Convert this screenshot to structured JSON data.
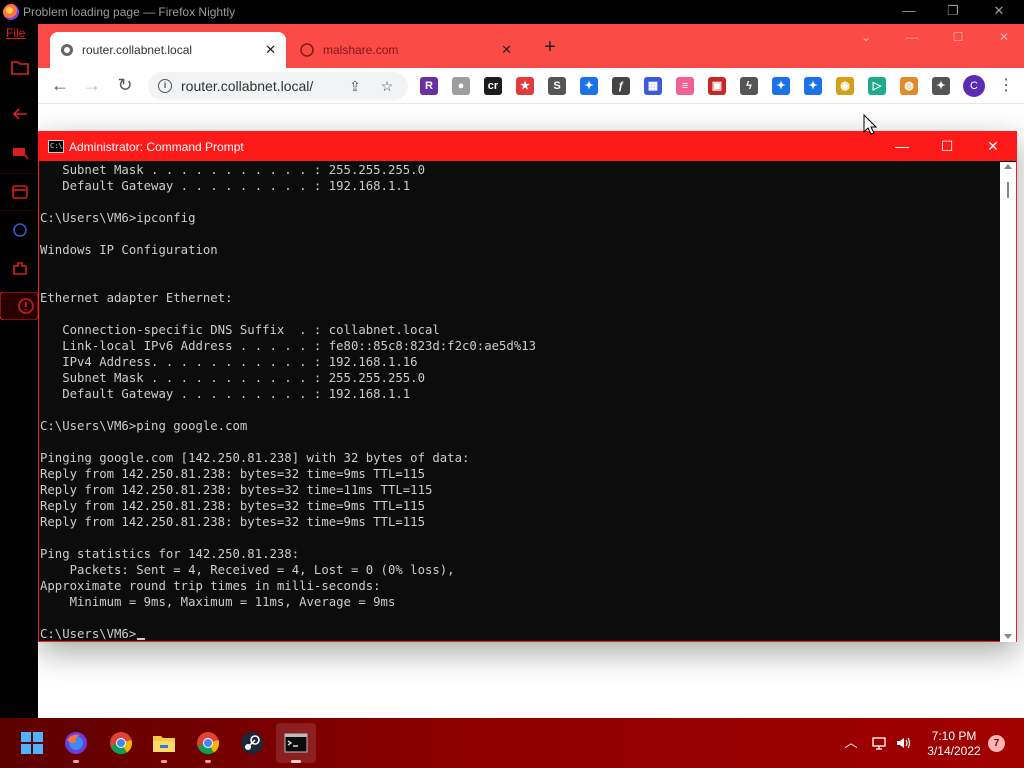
{
  "firefox": {
    "title": "Problem loading page — Firefox Nightly",
    "menu_file": "File",
    "controls": {
      "minimize": "—",
      "restore": "❐",
      "close": "✕"
    }
  },
  "chrome": {
    "tabs": [
      {
        "label": "router.collabnet.local",
        "close": "✕"
      },
      {
        "label": "malshare.com",
        "close": "✕"
      }
    ],
    "new_tab": "+",
    "controls": {
      "dropdown": "⌄",
      "minimize": "—",
      "maximize": "☐",
      "close": "✕"
    },
    "nav": {
      "back": "←",
      "forward": "→",
      "reload": "↻"
    },
    "address": "router.collabnet.local/",
    "omni": {
      "share": "⇪",
      "star": "☆"
    },
    "extensions": [
      {
        "icon": "r-extension-icon",
        "glyph": "R",
        "color": "#6a2fa0"
      },
      {
        "icon": "puzzle-grey-icon",
        "glyph": "●",
        "color": "#9e9e9e"
      },
      {
        "icon": "cr-extension-icon",
        "glyph": "cr",
        "color": "#1c1c1c"
      },
      {
        "icon": "red-shield-icon",
        "glyph": "★",
        "color": "#e23b3b"
      },
      {
        "icon": "s-extension-icon",
        "glyph": "S",
        "color": "#555555"
      },
      {
        "icon": "puzzle-blue-icon",
        "glyph": "✦",
        "color": "#1a73e8"
      },
      {
        "icon": "f-extension-icon",
        "glyph": "ƒ",
        "color": "#444444"
      },
      {
        "icon": "grid-extension-icon",
        "glyph": "▦",
        "color": "#3b5bdb"
      },
      {
        "icon": "flag-extension-icon",
        "glyph": "≡",
        "color": "#f06292"
      },
      {
        "icon": "image-extension-icon",
        "glyph": "▣",
        "color": "#c62828"
      },
      {
        "icon": "lightning-extension-icon",
        "glyph": "ϟ",
        "color": "#555555"
      },
      {
        "icon": "puzzle-blue-2-icon",
        "glyph": "✦",
        "color": "#1a73e8"
      },
      {
        "icon": "puzzle-blue-3-icon",
        "glyph": "✦",
        "color": "#1a73e8"
      },
      {
        "icon": "doge-extension-icon",
        "glyph": "◉",
        "color": "#d4a017"
      },
      {
        "icon": "play-extension-icon",
        "glyph": "▷",
        "color": "#1faa8e"
      },
      {
        "icon": "cookie-extension-icon",
        "glyph": "◍",
        "color": "#e08a2c"
      },
      {
        "icon": "extensions-puzzle-icon",
        "glyph": "✦",
        "color": "#555555"
      }
    ],
    "profile_initial": "C",
    "menu": "⋮"
  },
  "cmd": {
    "title": "Administrator: Command Prompt",
    "icon_text": "C:\\",
    "controls": {
      "minimize": "—",
      "maximize": "☐",
      "close": "✕"
    },
    "lines": [
      "   Subnet Mask . . . . . . . . . . . : 255.255.255.0",
      "   Default Gateway . . . . . . . . . : 192.168.1.1",
      "",
      "C:\\Users\\VM6>ipconfig",
      "",
      "Windows IP Configuration",
      "",
      "",
      "Ethernet adapter Ethernet:",
      "",
      "   Connection-specific DNS Suffix  . : collabnet.local",
      "   Link-local IPv6 Address . . . . . : fe80::85c8:823d:f2c0:ae5d%13",
      "   IPv4 Address. . . . . . . . . . . : 192.168.1.16",
      "   Subnet Mask . . . . . . . . . . . : 255.255.255.0",
      "   Default Gateway . . . . . . . . . : 192.168.1.1",
      "",
      "C:\\Users\\VM6>ping google.com",
      "",
      "Pinging google.com [142.250.81.238] with 32 bytes of data:",
      "Reply from 142.250.81.238: bytes=32 time=9ms TTL=115",
      "Reply from 142.250.81.238: bytes=32 time=11ms TTL=115",
      "Reply from 142.250.81.238: bytes=32 time=9ms TTL=115",
      "Reply from 142.250.81.238: bytes=32 time=9ms TTL=115",
      "",
      "Ping statistics for 142.250.81.238:",
      "    Packets: Sent = 4, Received = 4, Lost = 0 (0% loss),",
      "Approximate round trip times in milli-seconds:",
      "    Minimum = 9ms, Maximum = 11ms, Average = 9ms",
      ""
    ],
    "prompt": "C:\\Users\\VM6>"
  },
  "taskbar": {
    "apps": [
      "windows-start-icon",
      "firefox-icon",
      "chrome-icon",
      "file-explorer-icon",
      "chrome-2-icon",
      "steam-icon",
      "command-prompt-icon"
    ],
    "tray": {
      "chevron": "︿",
      "network": "▭",
      "volume": "🔈"
    },
    "time": "7:10 PM",
    "date": "3/14/2022",
    "notifications": "7"
  }
}
